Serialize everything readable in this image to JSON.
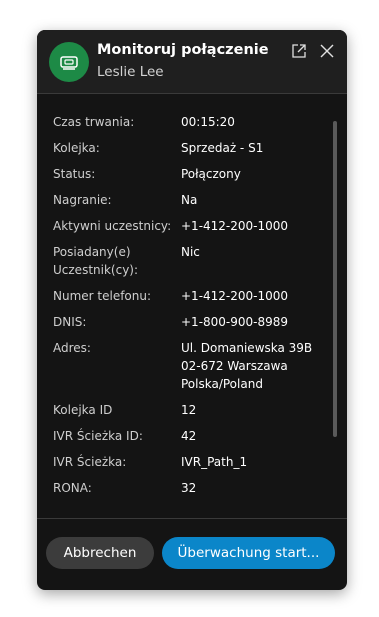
{
  "dialog": {
    "title": "Monitoruj połączenie",
    "subtitle": "Leslie Lee",
    "avatar_icon": "monitor-icon",
    "popout_icon": "popout-icon",
    "close_icon": "close-icon"
  },
  "details": [
    {
      "label": "Czas trwania:",
      "value": "00:15:20"
    },
    {
      "label": "Kolejka:",
      "value": "Sprzedaż - S1"
    },
    {
      "label": "Status:",
      "value": "Połączony"
    },
    {
      "label": "Nagranie:",
      "value": "Na"
    },
    {
      "label": "Aktywni uczestnicy:",
      "value": "+1-412-200-1000"
    },
    {
      "label": "Posiadany(e)",
      "label2": "Uczestnik(cy):",
      "value": "Nic"
    },
    {
      "label": "Numer telefonu:",
      "value": "+1-412-200-1000"
    },
    {
      "label": "DNIS:",
      "value": "+1-800-900-8989"
    },
    {
      "label": "Adres:",
      "value": "Ul. Domaniewska 39B",
      "value2": "02-672 Warszawa",
      "value3": "Polska/Poland"
    },
    {
      "label": "Kolejka ID",
      "value": "12"
    },
    {
      "label": "IVR Ścieżka ID:",
      "value": "42"
    },
    {
      "label": "IVR Ścieżka:",
      "value": "IVR_Path_1"
    },
    {
      "label": "RONA:",
      "value": "32"
    }
  ],
  "footer": {
    "cancel_label": "Abbrechen",
    "start_label": "Überwachung start..."
  },
  "colors": {
    "accent": "#0b86c9",
    "avatar": "#1d8a46",
    "background": "#141414"
  }
}
